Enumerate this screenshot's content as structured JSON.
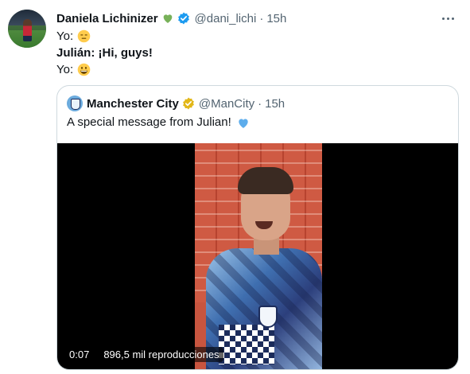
{
  "tweet": {
    "author_name": "Daniela Lichinizer",
    "author_handle": "@dani_lichi",
    "separator": "·",
    "time": "15h",
    "lines": [
      {
        "label": "Yo:",
        "emoji": "expressionless-face-icon"
      },
      {
        "speaker": "Julián:",
        "text": " ¡Hi, guys!"
      },
      {
        "label": "Yo:",
        "emoji": "grinning-face-icon"
      }
    ]
  },
  "quoted": {
    "author_name": "Manchester City",
    "author_handle": "@ManCity",
    "separator": "·",
    "time": "15h",
    "text": "A special message from Julian!",
    "video": {
      "duration": "0:07",
      "views": "896,5 mil reproducciones"
    }
  },
  "colors": {
    "text_primary": "#0f1419",
    "text_secondary": "#536471",
    "verified_blue": "#1d9bf0",
    "verified_gold": "#e2b719",
    "heart_green": "#78b159",
    "heart_blue": "#5dadec",
    "border": "#cfd9de"
  }
}
